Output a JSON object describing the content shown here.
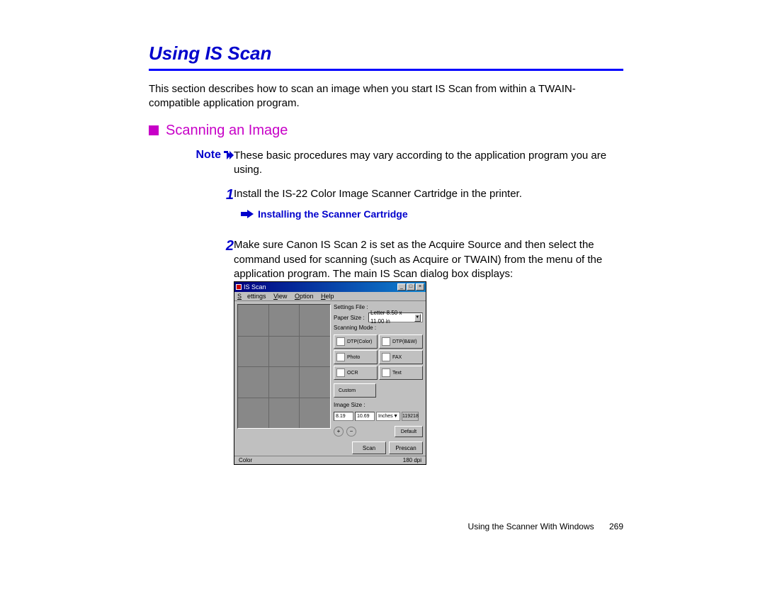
{
  "title": "Using IS Scan",
  "intro": "This section describes how to scan an image when you start IS Scan from within a TWAIN-compatible application program.",
  "subheading": "Scanning an Image",
  "note_label": "Note",
  "note_text": "These basic procedures may vary according to the application program you are using.",
  "step1_num": "1",
  "step1_text": "Install the IS-22 Color Image Scanner Cartridge in the printer.",
  "link_text": "Installing the Scanner Cartridge",
  "step2_num": "2",
  "step2_text": "Make sure Canon IS Scan 2 is set as the Acquire Source and then select the command used for scanning (such as Acquire or TWAIN) from the menu of the application program. The main IS Scan dialog box displays:",
  "dialog": {
    "title": "IS Scan",
    "menu": {
      "settings": "Settings",
      "view": "View",
      "option": "Option",
      "help": "Help"
    },
    "settings_file_label": "Settings File :",
    "paper_size_label": "Paper Size :",
    "paper_size_value": "Letter 8.50 x 11.00 in",
    "scanning_mode_label": "Scanning Mode :",
    "modes": {
      "dtp_color": "DTP(Color)",
      "dtp_bw": "DTP(B&W)",
      "photo": "Photo",
      "fax": "FAX",
      "ocr": "OCR",
      "text": "Text"
    },
    "custom": "Custom",
    "image_size_label": "Image Size :",
    "width": "8.19",
    "height": "10.69",
    "units": "Inches",
    "ratio": "119218",
    "default_btn": "Default",
    "scan_btn": "Scan",
    "prescan_btn": "Prescan",
    "status_left": "Color",
    "status_right": "180 dpi"
  },
  "footer_text": "Using the Scanner With Windows",
  "page_number": "269"
}
